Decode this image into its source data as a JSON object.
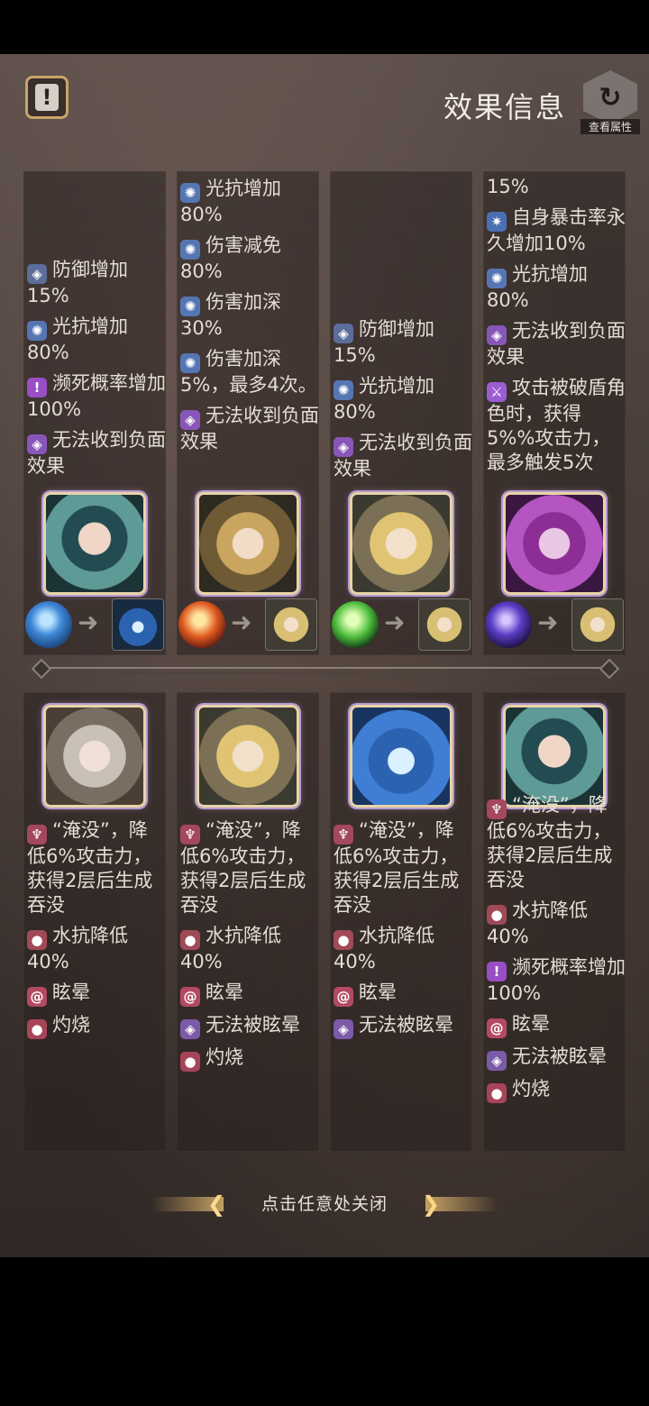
{
  "header": {
    "title": "效果信息",
    "view_attr_label": "查看属性"
  },
  "top_columns": [
    {
      "effects": [
        {
          "icon": "shield",
          "text": "防御增加15%"
        },
        {
          "icon": "light",
          "text": "光抗增加80%"
        },
        {
          "icon": "death",
          "text": "濒死概率增加100%"
        },
        {
          "icon": "immune",
          "text": "无法收到负面效果"
        }
      ],
      "portrait": "teal-haired-heroine",
      "chain": {
        "orb": "water-orb",
        "target": "frog-queen"
      }
    },
    {
      "effects": [
        {
          "icon": "light",
          "text": "光抗增加80%"
        },
        {
          "icon": "light",
          "text": "伤害减免80%"
        },
        {
          "icon": "light",
          "text": "伤害加深30%"
        },
        {
          "icon": "light",
          "text": "伤害加深5%，最多4次。"
        },
        {
          "icon": "immune",
          "text": "无法收到负面效果"
        }
      ],
      "portrait": "blonde-heroine",
      "chain": {
        "orb": "fire-orb",
        "target": "blonde-hero"
      }
    },
    {
      "effects": [
        {
          "icon": "shield",
          "text": "防御增加15%"
        },
        {
          "icon": "light",
          "text": "光抗增加80%"
        },
        {
          "icon": "immune",
          "text": "无法收到负面效果"
        }
      ],
      "portrait": "blonde-hero",
      "chain": {
        "orb": "nature-orb",
        "target": "blonde-hero"
      }
    },
    {
      "effects": [
        {
          "icon": "none",
          "text": "15%"
        },
        {
          "icon": "crit",
          "text": "自身暴击率永久增加10%"
        },
        {
          "icon": "light",
          "text": "光抗增加80%"
        },
        {
          "icon": "immune",
          "text": "无法收到负面效果"
        },
        {
          "icon": "sword",
          "text": "攻击被破盾角色时，获得5%%攻击力，最多触发5次"
        }
      ],
      "portrait": "purple-haired-heroine",
      "chain": {
        "orb": "void-orb",
        "target": "blonde-hero"
      }
    }
  ],
  "bottom_columns": [
    {
      "portrait": "white-haired-queen",
      "effects": [
        {
          "icon": "drown",
          "text": "“淹没”，降低6%攻击力，获得2层后生成吞没"
        },
        {
          "icon": "water",
          "text": "水抗降低40%"
        },
        {
          "icon": "stun",
          "text": "眩晕"
        },
        {
          "icon": "burn",
          "text": "灼烧"
        }
      ]
    },
    {
      "portrait": "blonde-hero",
      "effects": [
        {
          "icon": "drown",
          "text": "“淹没”，降低6%攻击力，获得2层后生成吞没"
        },
        {
          "icon": "water",
          "text": "水抗降低40%"
        },
        {
          "icon": "stun",
          "text": "眩晕"
        },
        {
          "icon": "nostun",
          "text": "无法被眩晕"
        },
        {
          "icon": "burn",
          "text": "灼烧"
        }
      ]
    },
    {
      "portrait": "frog-queen",
      "effects": [
        {
          "icon": "drown",
          "text": "“淹没”，降低6%攻击力，获得2层后生成吞没"
        },
        {
          "icon": "water",
          "text": "水抗降低40%"
        },
        {
          "icon": "stun",
          "text": "眩晕"
        },
        {
          "icon": "nostun",
          "text": "无法被眩晕"
        }
      ]
    },
    {
      "portrait": "teal-haired-heroine",
      "effects": [
        {
          "icon": "drown",
          "text": "“淹没”，降低6%攻击力，获得2层后生成吞没"
        },
        {
          "icon": "water",
          "text": "水抗降低40%"
        },
        {
          "icon": "death",
          "text": "濒死概率增加100%"
        },
        {
          "icon": "stun",
          "text": "眩晕"
        },
        {
          "icon": "nostun",
          "text": "无法被眩晕"
        },
        {
          "icon": "burn",
          "text": "灼烧"
        }
      ]
    }
  ],
  "footer": {
    "close_hint": "点击任意处关闭"
  }
}
